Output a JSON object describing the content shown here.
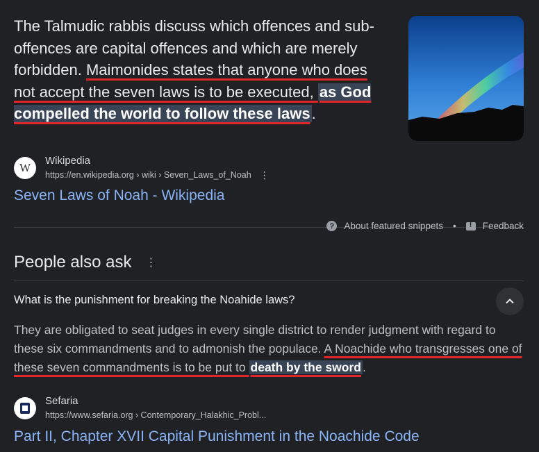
{
  "snippet": {
    "part1": "The Talmudic rabbis discuss which offences and sub-offences are capital offences and which are merely forbidden. ",
    "underlined": "Maimonides states that anyone who does not accept the seven laws is to be executed, ",
    "highlighted": "as God compelled the world to follow these laws",
    "end": "."
  },
  "source1": {
    "name": "Wikipedia",
    "favicon_letter": "W",
    "url": "https://en.wikipedia.org › wiki › Seven_Laws_of_Noah",
    "title": "Seven Laws of Noah - Wikipedia",
    "more_icon": "⋮"
  },
  "snippet_footer": {
    "about_label": "About featured snippets",
    "separator": "•",
    "feedback_label": "Feedback"
  },
  "paa": {
    "title": "People also ask",
    "more_icon": "⋮",
    "question": "What is the punishment for breaking the Noahide laws?",
    "chevron_icon": "chevron-up",
    "answer_part1": "They are obligated to seat judges in every single district to render judgment with regard to these six commandments and to admonish the populace. ",
    "answer_underlined": "A Noachide who transgresses one of these seven commandments is to be put to ",
    "answer_highlighted": "death by the sword",
    "answer_end": "."
  },
  "source2": {
    "name": "Sefaria",
    "url": "https://www.sefaria.org › Contemporary_Halakhic_Probl...",
    "title": "Part II, Chapter XVII Capital Punishment in the Noachide Code"
  },
  "colors": {
    "background": "#202124",
    "link": "#8ab4f8",
    "highlight": "#394457",
    "underline": "#e0262a"
  }
}
